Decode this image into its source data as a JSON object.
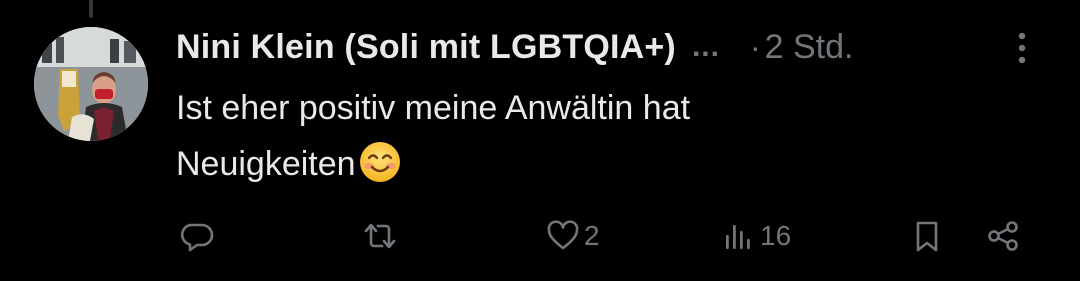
{
  "tweet": {
    "author": {
      "display_name": "Nini Klein (Soli mit LGBTQIA+)",
      "truncation": "...",
      "avatar_icon": "profile-photo"
    },
    "separator": "·",
    "timestamp": "2 Std.",
    "text_line_1": "Ist eher positiv meine Anwältin hat",
    "text_line_2": "Neuigkeiten",
    "emoji": "smiling-face-emoji",
    "actions": {
      "reply_icon": "speech-bubble-icon",
      "retweet_icon": "retweet-icon",
      "like_icon": "heart-icon",
      "like_count": "2",
      "views_icon": "bar-chart-icon",
      "views_count": "16",
      "bookmark_icon": "bookmark-icon",
      "share_icon": "share-icon"
    },
    "colors": {
      "background": "#000000",
      "primary_text": "#e7e9ea",
      "secondary_text": "#71767b"
    }
  }
}
